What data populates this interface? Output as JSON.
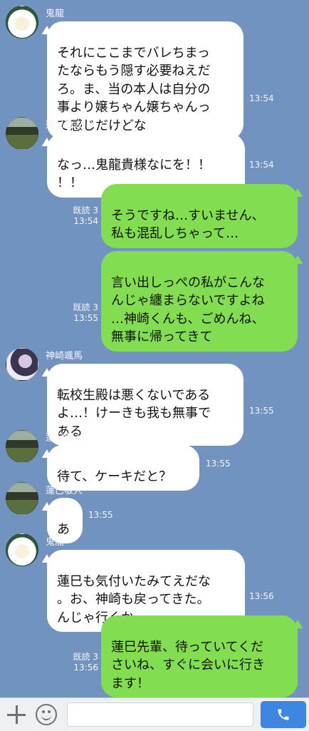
{
  "messages": [
    {
      "sender": "鬼龍",
      "text": "それにここまでバレちまっ\nたならもう隠す必要ねえだ\nろ。ま、当の本人は自分の\n事より嬢ちゃん嬢ちゃんっ\nて感じだけどな",
      "time": "13:54"
    },
    {
      "sender": "蓮巳敬人",
      "text": "なっ…鬼龍貴様なにを！！\n！！",
      "time": "13:54"
    },
    {
      "read": "既読 3",
      "text": "そうですね…すいません、\n私も混乱しちゃって…",
      "time": "13:54"
    },
    {
      "read": "既読 3",
      "text": "言い出しっぺの私がこんな\nんじゃ纏まらないですよね\n…神崎くんも、ごめんね、\n無事に帰ってきて",
      "time": "13:55"
    },
    {
      "sender": "神崎颯馬",
      "text": "転校生殿は悪くないである\nよ…！けーきも我も無事で\nある",
      "time": "13:55"
    },
    {
      "sender": "蓮巳敬人",
      "text": "待て、ケーキだと？",
      "time": "13:55"
    },
    {
      "sender": "蓮巳敬人",
      "text": "あ",
      "time": "13:55"
    },
    {
      "sender": "鬼龍",
      "text": "蓮巳も気付いたみてえだな\n。お、神崎も戻ってきた。\nんじゃ行くか",
      "time": "13:56"
    },
    {
      "read": "既読 3",
      "text": "蓮巳先輩、待っていてくだ\nさいね、すぐに会いに行き\nます！",
      "time": "13:56"
    }
  ],
  "colors": {
    "background": "#7292c0",
    "incoming": "#ffffff",
    "outgoing": "#82dd50",
    "call_button": "#3d86e2"
  },
  "input_bar": {
    "plus_icon": "plus-icon",
    "emoji_icon": "smile-icon",
    "call_icon": "phone-icon",
    "placeholder": ""
  }
}
